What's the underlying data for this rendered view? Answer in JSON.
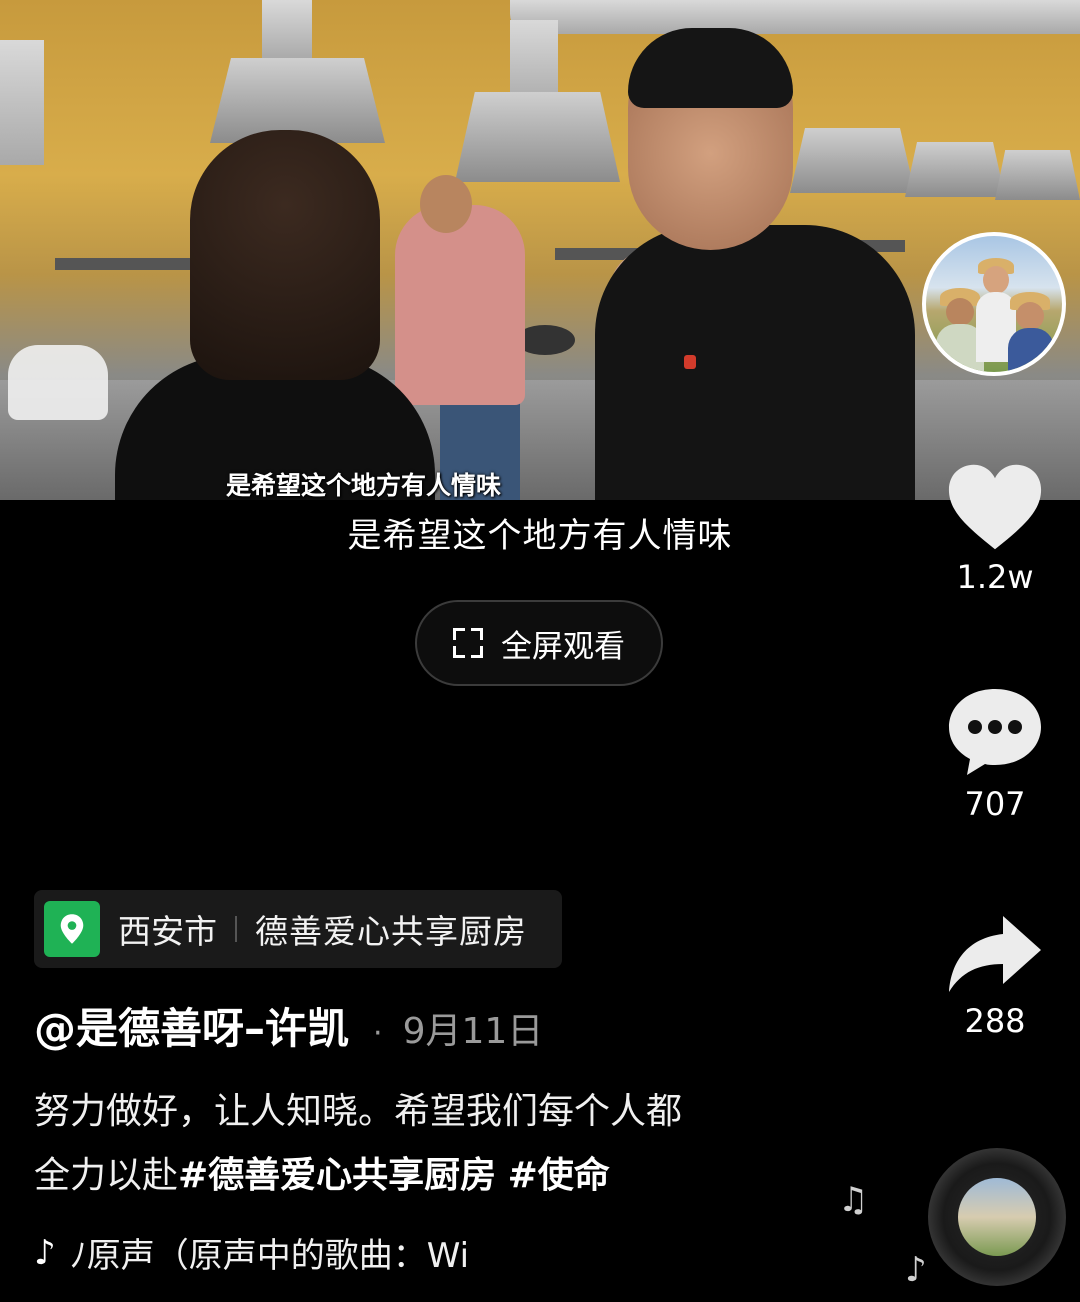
{
  "video": {
    "caption": "是希望这个地方有人情味"
  },
  "subtitle": "是希望这个地方有人情味",
  "fullscreen": {
    "label": "全屏观看",
    "icon": "fullscreen-icon"
  },
  "rail": {
    "like_count": "1.2w",
    "comment_count": "707",
    "share_count": "288"
  },
  "location": {
    "city": "西安市",
    "place": "德善爱心共享厨房",
    "icon_color": "#1fb255"
  },
  "author": {
    "name": "@是德善呀–许凯",
    "separator": "·",
    "date": "9月11日"
  },
  "description": {
    "line1": "努力做好，让人知晓。希望我们每个人都",
    "line2_prefix": "全力以赴",
    "tag1": "#德善爱心共享厨房",
    "tag2": "#使命"
  },
  "music": {
    "text": "ﾉ原声（原声中的歌曲：Wi"
  }
}
